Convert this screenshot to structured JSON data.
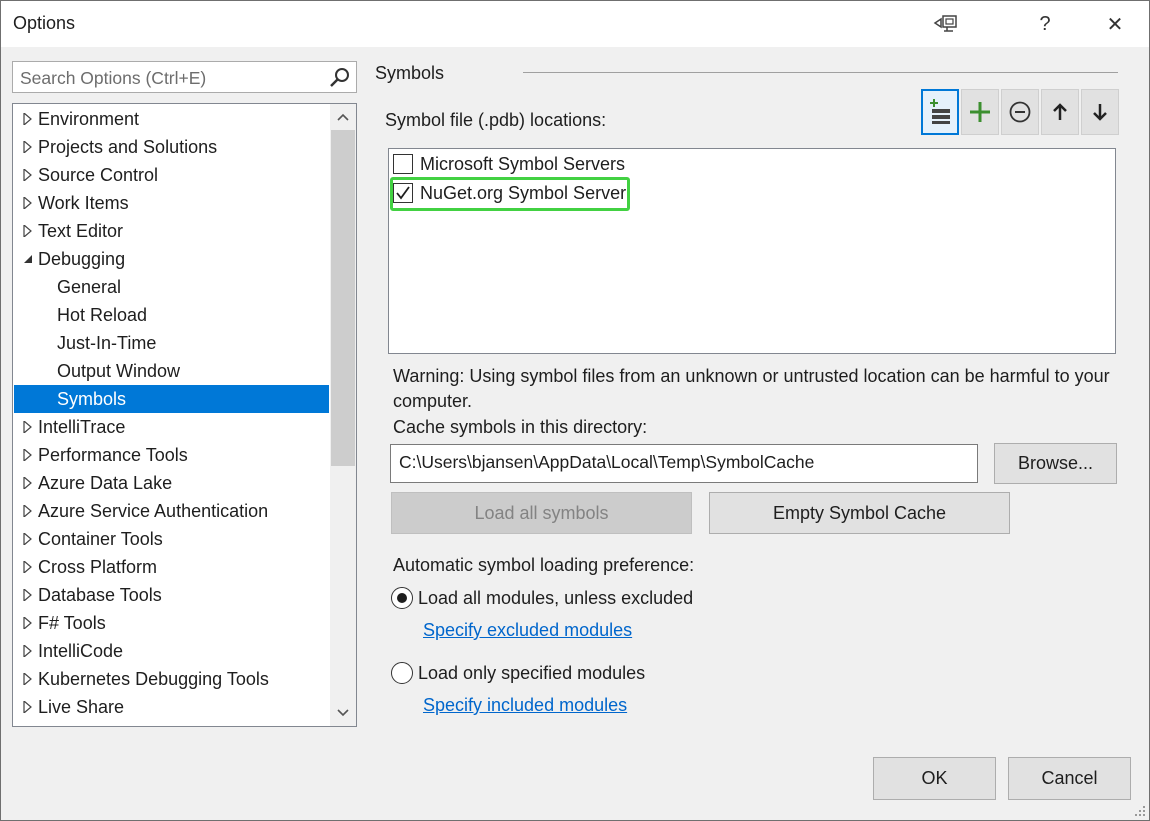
{
  "window": {
    "title": "Options",
    "help_label": "?",
    "close_label": "✕"
  },
  "search": {
    "placeholder": "Search Options (Ctrl+E)"
  },
  "tree": {
    "items": [
      {
        "label": "Environment",
        "state": "collapsed"
      },
      {
        "label": "Projects and Solutions",
        "state": "collapsed"
      },
      {
        "label": "Source Control",
        "state": "collapsed"
      },
      {
        "label": "Work Items",
        "state": "collapsed"
      },
      {
        "label": "Text Editor",
        "state": "collapsed"
      },
      {
        "label": "Debugging",
        "state": "expanded"
      },
      {
        "label": "General",
        "state": "child"
      },
      {
        "label": "Hot Reload",
        "state": "child"
      },
      {
        "label": "Just-In-Time",
        "state": "child"
      },
      {
        "label": "Output Window",
        "state": "child"
      },
      {
        "label": "Symbols",
        "state": "child-selected"
      },
      {
        "label": "IntelliTrace",
        "state": "collapsed"
      },
      {
        "label": "Performance Tools",
        "state": "collapsed"
      },
      {
        "label": "Azure Data Lake",
        "state": "collapsed"
      },
      {
        "label": "Azure Service Authentication",
        "state": "collapsed"
      },
      {
        "label": "Container Tools",
        "state": "collapsed"
      },
      {
        "label": "Cross Platform",
        "state": "collapsed"
      },
      {
        "label": "Database Tools",
        "state": "collapsed"
      },
      {
        "label": "F# Tools",
        "state": "collapsed"
      },
      {
        "label": "IntelliCode",
        "state": "collapsed"
      },
      {
        "label": "Kubernetes Debugging Tools",
        "state": "collapsed"
      },
      {
        "label": "Live Share",
        "state": "collapsed"
      }
    ]
  },
  "symbols": {
    "section_title": "Symbols",
    "locations_label": "Symbol file (.pdb) locations:",
    "locations": [
      {
        "label": "Microsoft Symbol Servers",
        "checked": false
      },
      {
        "label": "NuGet.org Symbol Server",
        "checked": true
      }
    ],
    "warning": "Warning: Using symbol files from an unknown or untrusted location can be harmful to your computer.",
    "cache_label": "Cache symbols in this directory:",
    "cache_path": "C:\\Users\\bjansen\\AppData\\Local\\Temp\\SymbolCache",
    "browse_label": "Browse...",
    "load_all_label": "Load all symbols",
    "empty_cache_label": "Empty Symbol Cache",
    "pref_label": "Automatic symbol loading preference:",
    "radio_all": "Load all modules, unless excluded",
    "link_excluded": "Specify excluded modules",
    "radio_specified": "Load only specified modules",
    "link_included": "Specify included modules",
    "selected_radio": "all"
  },
  "toolbar": {
    "icons": [
      "add-from-list-icon",
      "plus-icon",
      "minus-circle-icon",
      "arrow-up-icon",
      "arrow-down-icon"
    ],
    "accent": "#0078d7",
    "green": "#3c8f2f"
  },
  "footer": {
    "ok_label": "OK",
    "cancel_label": "Cancel"
  }
}
